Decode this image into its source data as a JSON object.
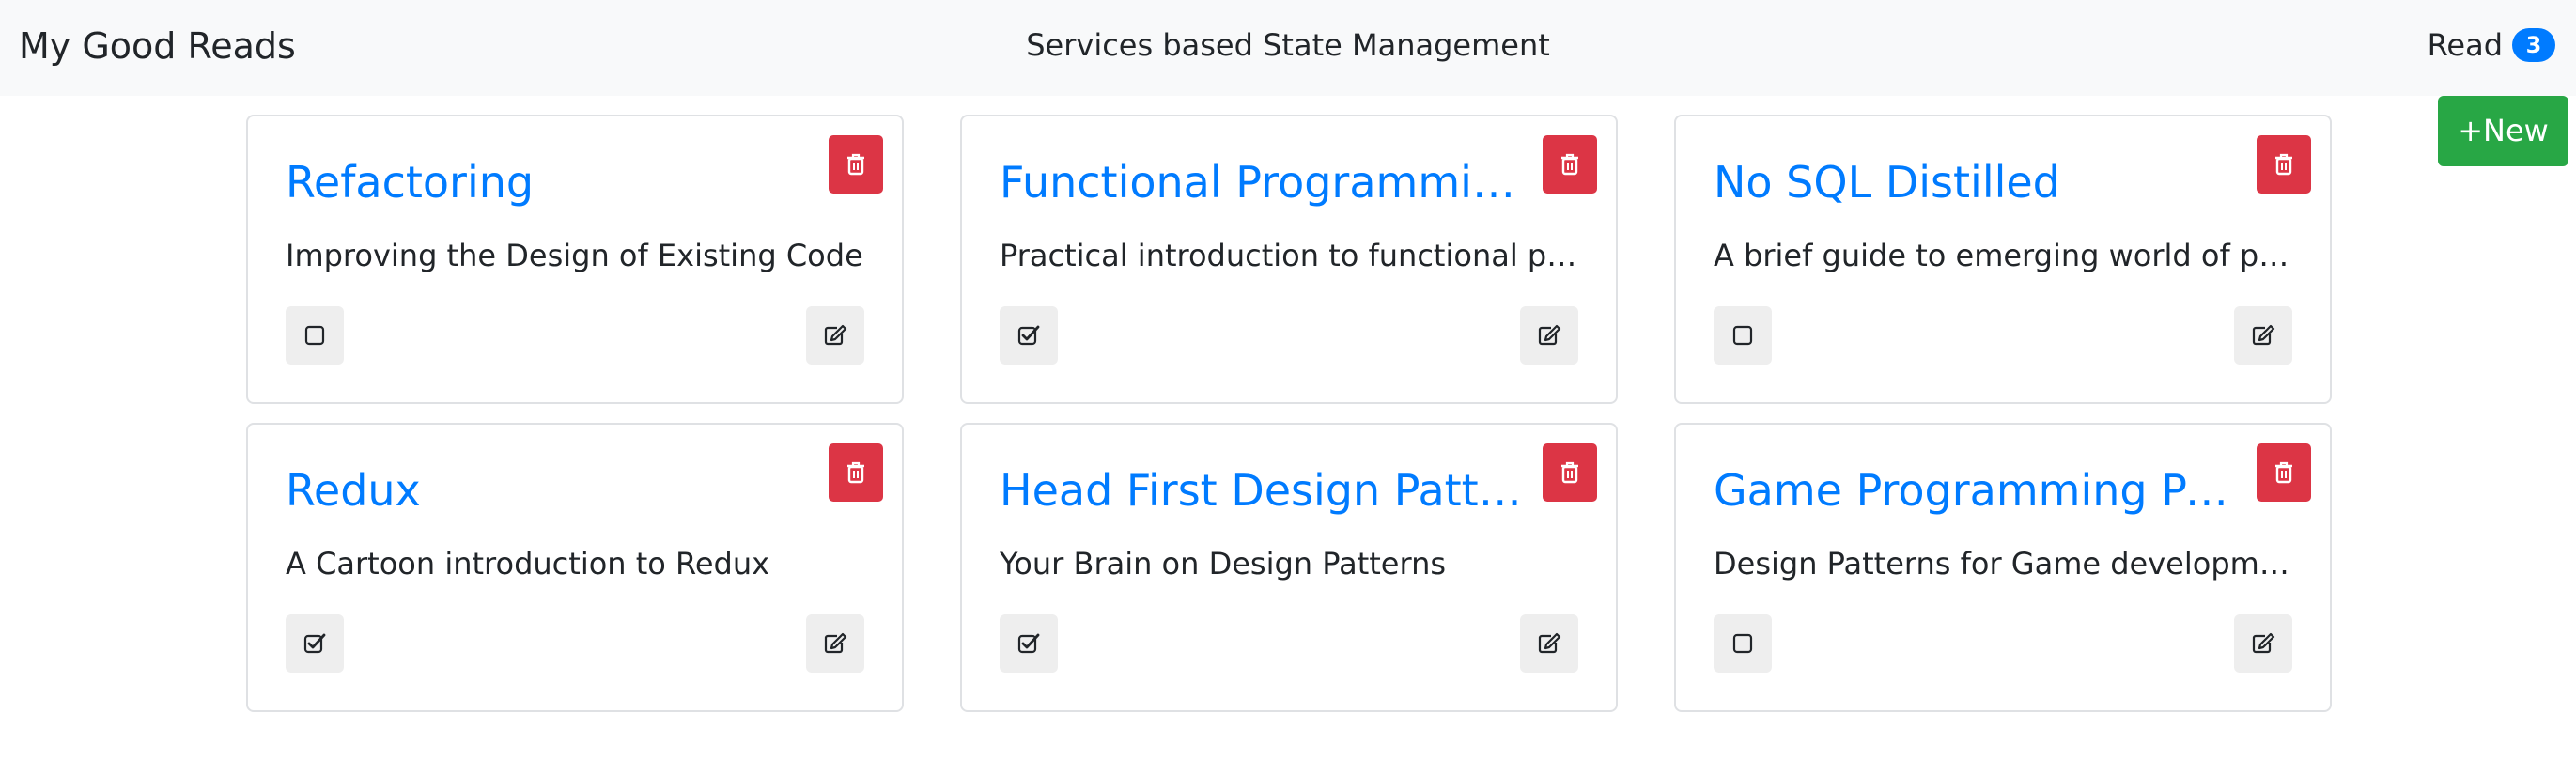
{
  "header": {
    "brand": "My Good Reads",
    "title": "Services based State Management",
    "read_label": "Read",
    "read_count": "3"
  },
  "actions": {
    "new_label": "+New"
  },
  "colors": {
    "primary": "#007bff",
    "danger": "#dc3545",
    "success": "#28a745",
    "navbar_bg": "#f8f9fa"
  },
  "books": [
    {
      "title": "Refactoring",
      "subtitle": "Improving the Design of Existing Code",
      "read": false
    },
    {
      "title": "Functional Programming",
      "subtitle": "Practical introduction to functional programming",
      "read": true
    },
    {
      "title": "No SQL Distilled",
      "subtitle": "A brief guide to emerging world of polyglot persistence",
      "read": false
    },
    {
      "title": "Redux",
      "subtitle": "A Cartoon introduction to Redux",
      "read": true
    },
    {
      "title": "Head First Design Patterns",
      "subtitle": "Your Brain on Design Patterns",
      "read": true
    },
    {
      "title": "Game Programming Patterns",
      "subtitle": "Design Patterns for Game development",
      "read": false
    }
  ],
  "icons": {
    "delete": "trash-icon",
    "unread": "square-icon",
    "read": "check-square-icon",
    "edit": "edit-icon"
  }
}
